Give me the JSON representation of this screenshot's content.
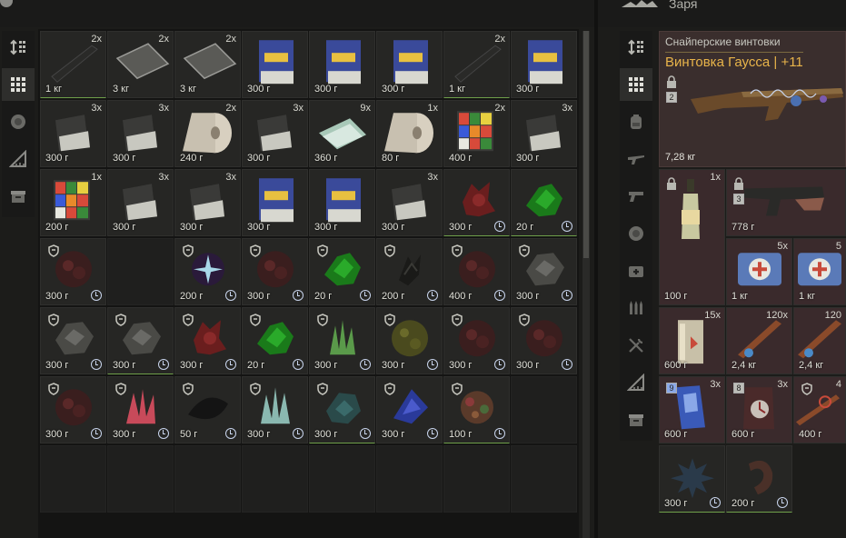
{
  "header": {
    "right_owner_name": "Заря"
  },
  "left_toolbar": {
    "tabs": [
      {
        "icon": "sort-icon"
      },
      {
        "icon": "grid-icon"
      },
      {
        "icon": "artifact-icon"
      },
      {
        "icon": "ruler-icon"
      },
      {
        "icon": "box-icon"
      }
    ]
  },
  "right_toolbar": {
    "tabs": [
      {
        "icon": "sort-icon"
      },
      {
        "icon": "grid-icon"
      },
      {
        "icon": "backpack-icon"
      },
      {
        "icon": "rifle-icon"
      },
      {
        "icon": "pistol-icon"
      },
      {
        "icon": "artifact-icon"
      },
      {
        "icon": "medkit-icon"
      },
      {
        "icon": "ammo-icon"
      },
      {
        "icon": "tools-icon"
      },
      {
        "icon": "ruler-icon"
      },
      {
        "icon": "box-icon"
      }
    ]
  },
  "stash": {
    "rows": [
      [
        {
          "qty": "2x",
          "weight": "1 кг",
          "art": "stick"
        },
        {
          "qty": "2x",
          "weight": "3 кг",
          "art": "plate"
        },
        {
          "qty": "2x",
          "weight": "3 кг",
          "art": "plate"
        },
        {
          "qty": "",
          "weight": "300 г",
          "art": "book"
        },
        {
          "qty": "",
          "weight": "300 г",
          "art": "book"
        },
        {
          "qty": "",
          "weight": "300 г",
          "art": "book"
        },
        {
          "qty": "2x",
          "weight": "1 кг",
          "art": "stick"
        },
        {
          "qty": "",
          "weight": "300 г",
          "art": "book"
        }
      ],
      [
        {
          "qty": "3x",
          "weight": "300 г",
          "art": "box"
        },
        {
          "qty": "3x",
          "weight": "300 г",
          "art": "box"
        },
        {
          "qty": "2x",
          "weight": "240 г",
          "art": "roll"
        },
        {
          "qty": "3x",
          "weight": "300 г",
          "art": "box"
        },
        {
          "qty": "9x",
          "weight": "360 г",
          "art": "cash"
        },
        {
          "qty": "1x",
          "weight": "80 г",
          "art": "roll"
        },
        {
          "qty": "2x",
          "weight": "400 г",
          "art": "cube"
        },
        {
          "qty": "3x",
          "weight": "300 г",
          "art": "box"
        }
      ],
      [
        {
          "qty": "1x",
          "weight": "200 г",
          "art": "cube"
        },
        {
          "qty": "3x",
          "weight": "300 г",
          "art": "box"
        },
        {
          "qty": "3x",
          "weight": "300 г",
          "art": "box"
        },
        {
          "qty": "",
          "weight": "300 г",
          "art": "book"
        },
        {
          "qty": "",
          "weight": "300 г",
          "art": "book"
        },
        {
          "qty": "3x",
          "weight": "300 г",
          "art": "box"
        },
        {
          "qty": "",
          "weight": "300 г",
          "art": "red-blob",
          "clock": true
        },
        {
          "qty": "",
          "weight": "20 г",
          "art": "green-blob",
          "clock": true
        }
      ],
      [
        {
          "qty": "",
          "weight": "300 г",
          "art": "dark-red",
          "clock": true,
          "shield": true
        },
        {
          "empty": true
        },
        {
          "qty": "",
          "weight": "200 г",
          "art": "spark",
          "clock": true,
          "shield": true
        },
        {
          "qty": "",
          "weight": "300 г",
          "art": "dark-red",
          "clock": true,
          "shield": true
        },
        {
          "qty": "",
          "weight": "20 г",
          "art": "green-blob",
          "clock": true,
          "shield": true
        },
        {
          "qty": "",
          "weight": "200 г",
          "art": "dark-claw",
          "clock": true,
          "shield": true
        },
        {
          "qty": "",
          "weight": "400 г",
          "art": "dark-red",
          "clock": true,
          "shield": true
        },
        {
          "qty": "",
          "weight": "300 г",
          "art": "grey-rock",
          "clock": true,
          "shield": true
        }
      ],
      [
        {
          "qty": "",
          "weight": "300 г",
          "art": "grey-rock",
          "clock": true,
          "shield": true
        },
        {
          "qty": "",
          "weight": "300 г",
          "art": "grey-rock",
          "clock": true,
          "shield": true
        },
        {
          "qty": "",
          "weight": "300 г",
          "art": "red-blob",
          "clock": true,
          "shield": true
        },
        {
          "qty": "",
          "weight": "20 г",
          "art": "green-blob",
          "clock": true,
          "shield": true
        },
        {
          "qty": "",
          "weight": "300 г",
          "art": "green-crystal",
          "clock": true,
          "shield": true
        },
        {
          "qty": "",
          "weight": "300 г",
          "art": "olive-blob",
          "clock": true,
          "shield": true
        },
        {
          "qty": "",
          "weight": "300 г",
          "art": "dark-red",
          "clock": true,
          "shield": true
        },
        {
          "qty": "",
          "weight": "300 г",
          "art": "dark-red",
          "clock": true,
          "shield": true
        }
      ],
      [
        {
          "qty": "",
          "weight": "300 г",
          "art": "dark-red",
          "clock": true,
          "shield": true
        },
        {
          "qty": "",
          "weight": "300 г",
          "art": "pink-crystal",
          "clock": true,
          "shield": true
        },
        {
          "qty": "",
          "weight": "50 г",
          "art": "black-leaf",
          "clock": true,
          "shield": true
        },
        {
          "qty": "",
          "weight": "300 г",
          "art": "ice-crystal",
          "clock": true,
          "shield": true
        },
        {
          "qty": "",
          "weight": "300 г",
          "art": "teal-blob",
          "clock": true,
          "shield": true
        },
        {
          "qty": "",
          "weight": "300 г",
          "art": "blue-shard",
          "clock": true,
          "shield": true
        },
        {
          "qty": "",
          "weight": "100 г",
          "art": "flower-blob",
          "clock": true,
          "shield": true
        },
        {
          "empty": true
        }
      ],
      [
        {
          "empty": true
        },
        {
          "empty": true
        },
        {
          "empty": true
        },
        {
          "empty": true
        },
        {
          "empty": true
        },
        {
          "empty": true
        },
        {
          "empty": true
        },
        {
          "empty": true
        }
      ]
    ]
  },
  "trader": {
    "weapon": {
      "category": "Снайперские винтовки",
      "name": "Винтовка Гаусса | +11",
      "badge": "2",
      "weight": "7,28 кг"
    },
    "items": [
      {
        "qty": "1x",
        "weight": "100 г",
        "art": "bottle",
        "lock": true
      },
      {
        "qty": "",
        "weight": "778 г",
        "art": "pistol",
        "lock": true,
        "badge": "3"
      },
      {
        "qty": "5x",
        "weight": "1 кг",
        "art": "medkit"
      },
      {
        "qty": "5",
        "weight": "1 кг",
        "art": "medkit"
      },
      {
        "qty": "15x",
        "weight": "600 г",
        "art": "extinguisher"
      },
      {
        "qty": "120x",
        "weight": "2,4 кг",
        "art": "cigar"
      },
      {
        "qty": "120",
        "weight": "2,4 кг",
        "art": "cigar"
      },
      {
        "qty": "3x",
        "weight": "600 г",
        "art": "can",
        "badge": "9"
      },
      {
        "qty": "3x",
        "weight": "600 г",
        "art": "canister",
        "badge": "8"
      },
      {
        "qty": "4",
        "weight": "400 г",
        "art": "rod",
        "shield": true
      },
      {
        "qty": "",
        "weight": "300 г",
        "art": "spiky",
        "clock": true
      },
      {
        "qty": "",
        "weight": "200 г",
        "art": "claw",
        "clock": true
      }
    ]
  },
  "colors": {
    "accent_gold": "#e8b44a",
    "cell_bg": "#262624",
    "pink_cell": "#3a2a2c"
  }
}
